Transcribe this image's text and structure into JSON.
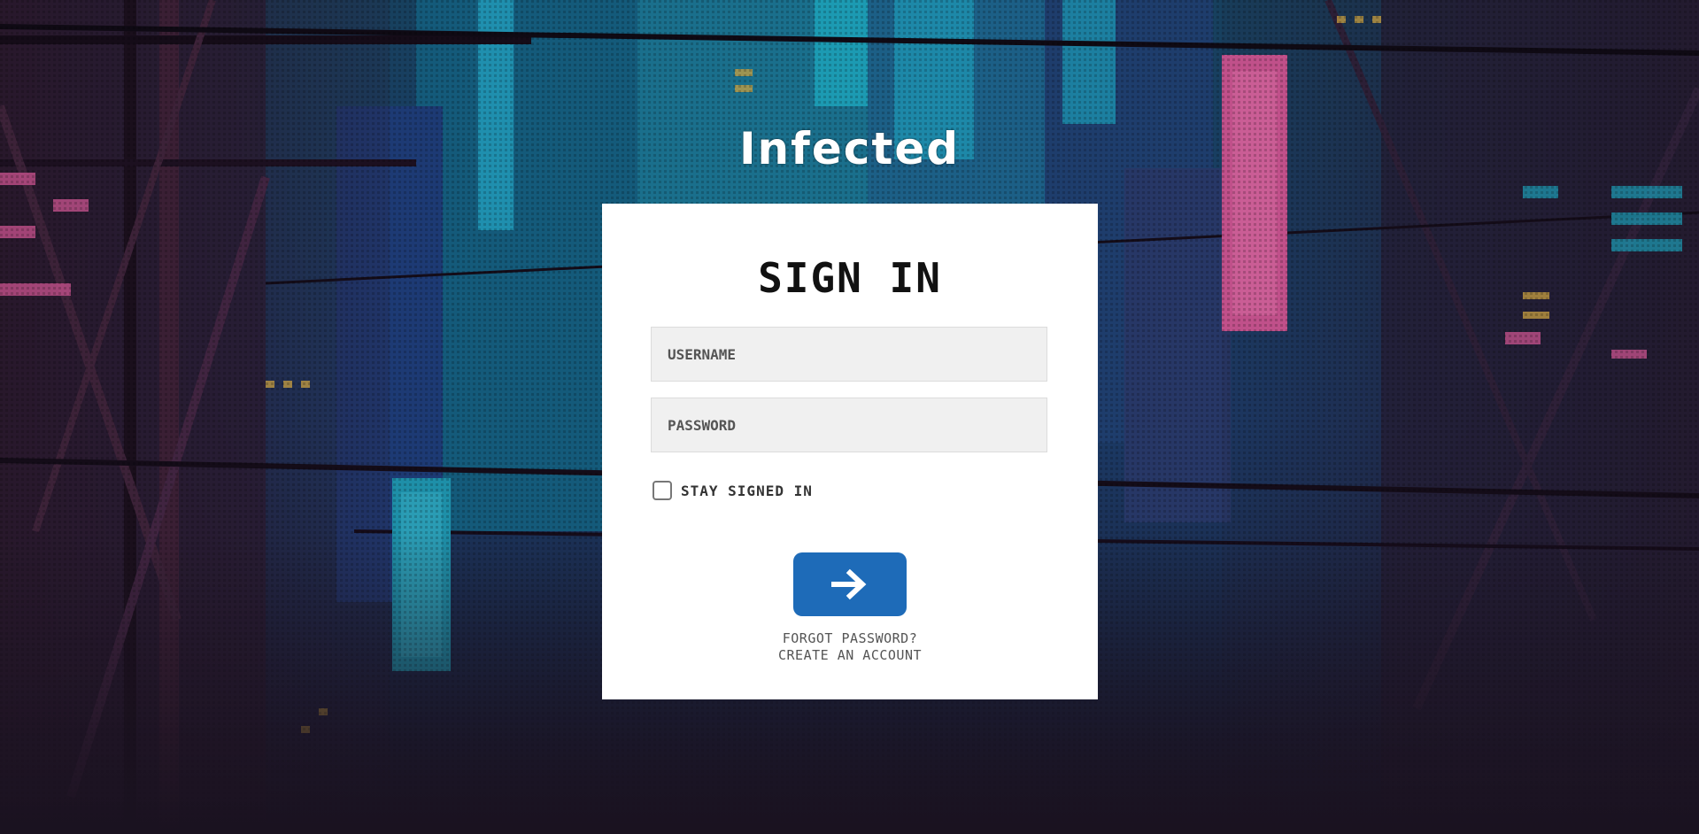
{
  "app": {
    "logo_text": "Infected"
  },
  "login": {
    "title": "SIGN IN",
    "username_placeholder": "USERNAME",
    "password_placeholder": "PASSWORD",
    "remember_label": "STAY SIGNED IN",
    "submit_icon": "arrow-right-icon",
    "forgot_password": "FORGOT PASSWORD?",
    "create_account": "CREATE AN ACCOUNT"
  },
  "colors": {
    "background": "#1a1628",
    "card": "#ffffff",
    "field": "#f0f0f0",
    "submit": "#1e6bb8",
    "accent_teal": "#1e8fa8",
    "accent_pink": "#c0508a"
  }
}
